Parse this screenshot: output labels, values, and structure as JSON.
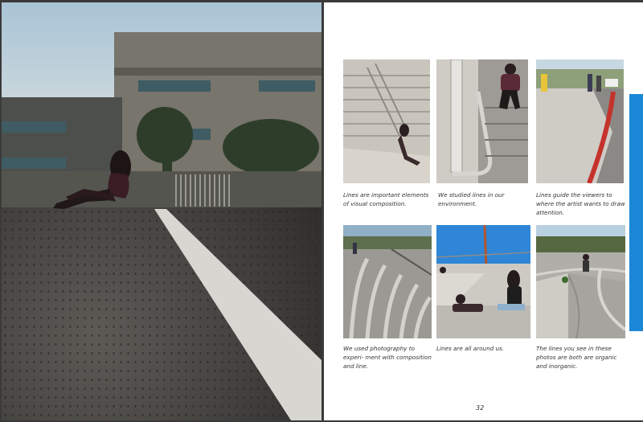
{
  "page": {
    "number": "32"
  },
  "captions": [
    "Lines are important elements of visual composition.",
    "We studied lines in our environment.",
    "Lines guide the viewers to where the artist wants to draw attention.",
    "We used photography to experi- ment with composition and line.",
    "Lines are all around us.",
    "The lines you see in these photos are both are organic and inorganic."
  ],
  "colors": {
    "accent_bar": "#1b87d6",
    "page_background": "#ffffff",
    "spread_background": "#3a3a3a"
  },
  "images": {
    "left_full_page": "girl-sitting-on-pavement-photo",
    "grid": [
      "stairs-with-railing-photo",
      "girl-on-steps-railing-photo",
      "red-curb-street-photo",
      "curved-bleacher-steps-photo",
      "girls-on-ramp-wall-photo",
      "curving-ramp-railing-photo"
    ]
  }
}
